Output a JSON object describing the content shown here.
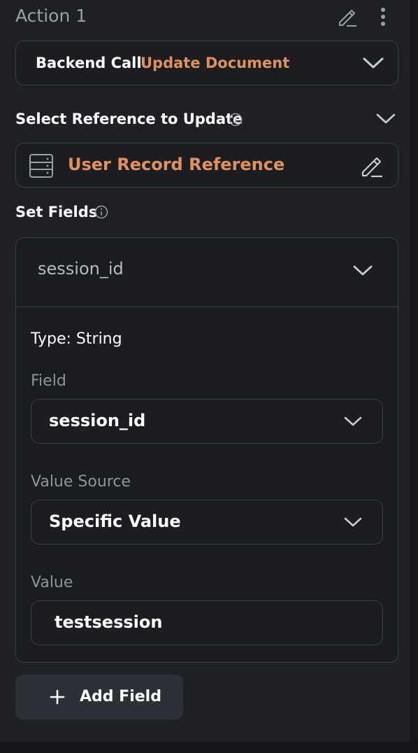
{
  "action": {
    "title": "Action 1",
    "type_label": "Backend Call",
    "type_value": "Update Document"
  },
  "reference": {
    "section_label": "Select Reference to Update",
    "value": "User Record Reference"
  },
  "set_fields": {
    "section_label": "Set Fields",
    "field_name": "session_id",
    "type_text": "Type: String",
    "field_label": "Field",
    "field_value": "session_id",
    "value_source_label": "Value Source",
    "value_source_value": "Specific Value",
    "value_label": "Value",
    "value_value": "testsession"
  },
  "add_field_label": "Add Field",
  "colors": {
    "background": "#1e2024",
    "accent": "#e0915c",
    "border": "#3a3e45",
    "button": "#2c3037"
  }
}
